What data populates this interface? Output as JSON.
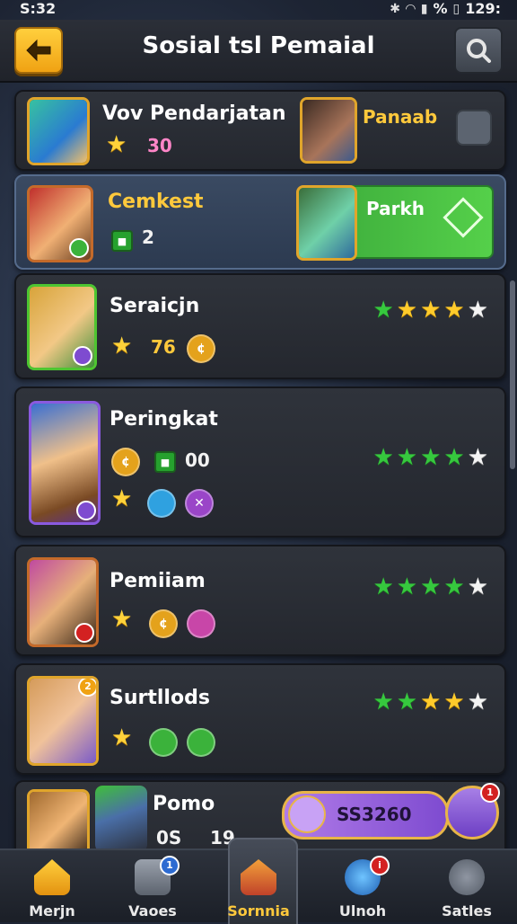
{
  "status": {
    "time": "S:32",
    "right_text": "129:",
    "signal": "%"
  },
  "header": {
    "title": "Sosial tsl Pemaial"
  },
  "rows": [
    {
      "name": "Vov Pendarjatan",
      "value": "30",
      "right_name": "Panaab"
    },
    {
      "name": "Cemkest",
      "value": "2",
      "right_name": "Parkh"
    },
    {
      "name": "Seraicjn",
      "value": "76",
      "stars": 4
    },
    {
      "name": "Peringkat",
      "value": "00",
      "stars": 4
    },
    {
      "name": "Pemiiam",
      "stars": 4
    },
    {
      "name": "Surtllods",
      "stars": 4
    },
    {
      "name": "Pomo",
      "value_a": "0S",
      "value_b": "19",
      "pill_value": "SS3260"
    }
  ],
  "badges": {
    "row6_avatar": "2",
    "pill_notif": "1",
    "nav_vaoes": "1",
    "nav_ulnoh": "i"
  },
  "nav": [
    {
      "label": "Merjn"
    },
    {
      "label": "Vaoes"
    },
    {
      "label": "Sornnia"
    },
    {
      "label": "Ulnoh"
    },
    {
      "label": "Satles"
    }
  ],
  "colors": {
    "accent_gold": "#ffc93c",
    "green": "#36c83e",
    "purple": "#8a5adf"
  }
}
